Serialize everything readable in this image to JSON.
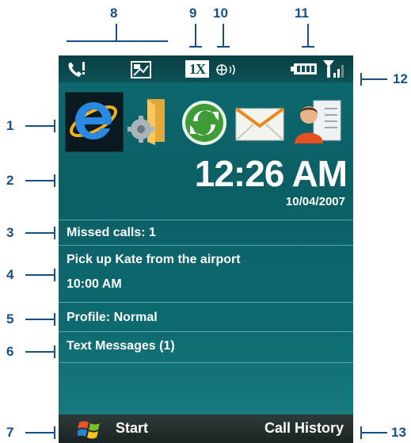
{
  "callouts": [
    "1",
    "2",
    "3",
    "4",
    "5",
    "6",
    "7",
    "8",
    "9",
    "10",
    "11",
    "12",
    "13"
  ],
  "status_bar": {
    "icons": [
      "missed-call-icon",
      "sim-manager-icon",
      "1x-data-icon",
      "roaming-icon",
      "battery-icon",
      "signal-strength-icon"
    ],
    "data_label": "1X"
  },
  "apps": [
    "internet-explorer-icon",
    "settings-folder-icon",
    "activesync-icon",
    "messaging-envelope-icon",
    "contacts-icon"
  ],
  "clock": {
    "time": "12:26 AM",
    "date": "10/04/2007"
  },
  "today_items": {
    "missed_calls": "Missed calls: 1",
    "appointment_title": "Pick up Kate from the airport",
    "appointment_time": "10:00 AM",
    "profile": "Profile: Normal",
    "text_messages": "Text Messages (1)"
  },
  "softkeys": {
    "left": "Start",
    "right": "Call History"
  },
  "colors": {
    "callout": "#1a4f86",
    "background": "#0b5e64",
    "text": "#ffffff"
  }
}
